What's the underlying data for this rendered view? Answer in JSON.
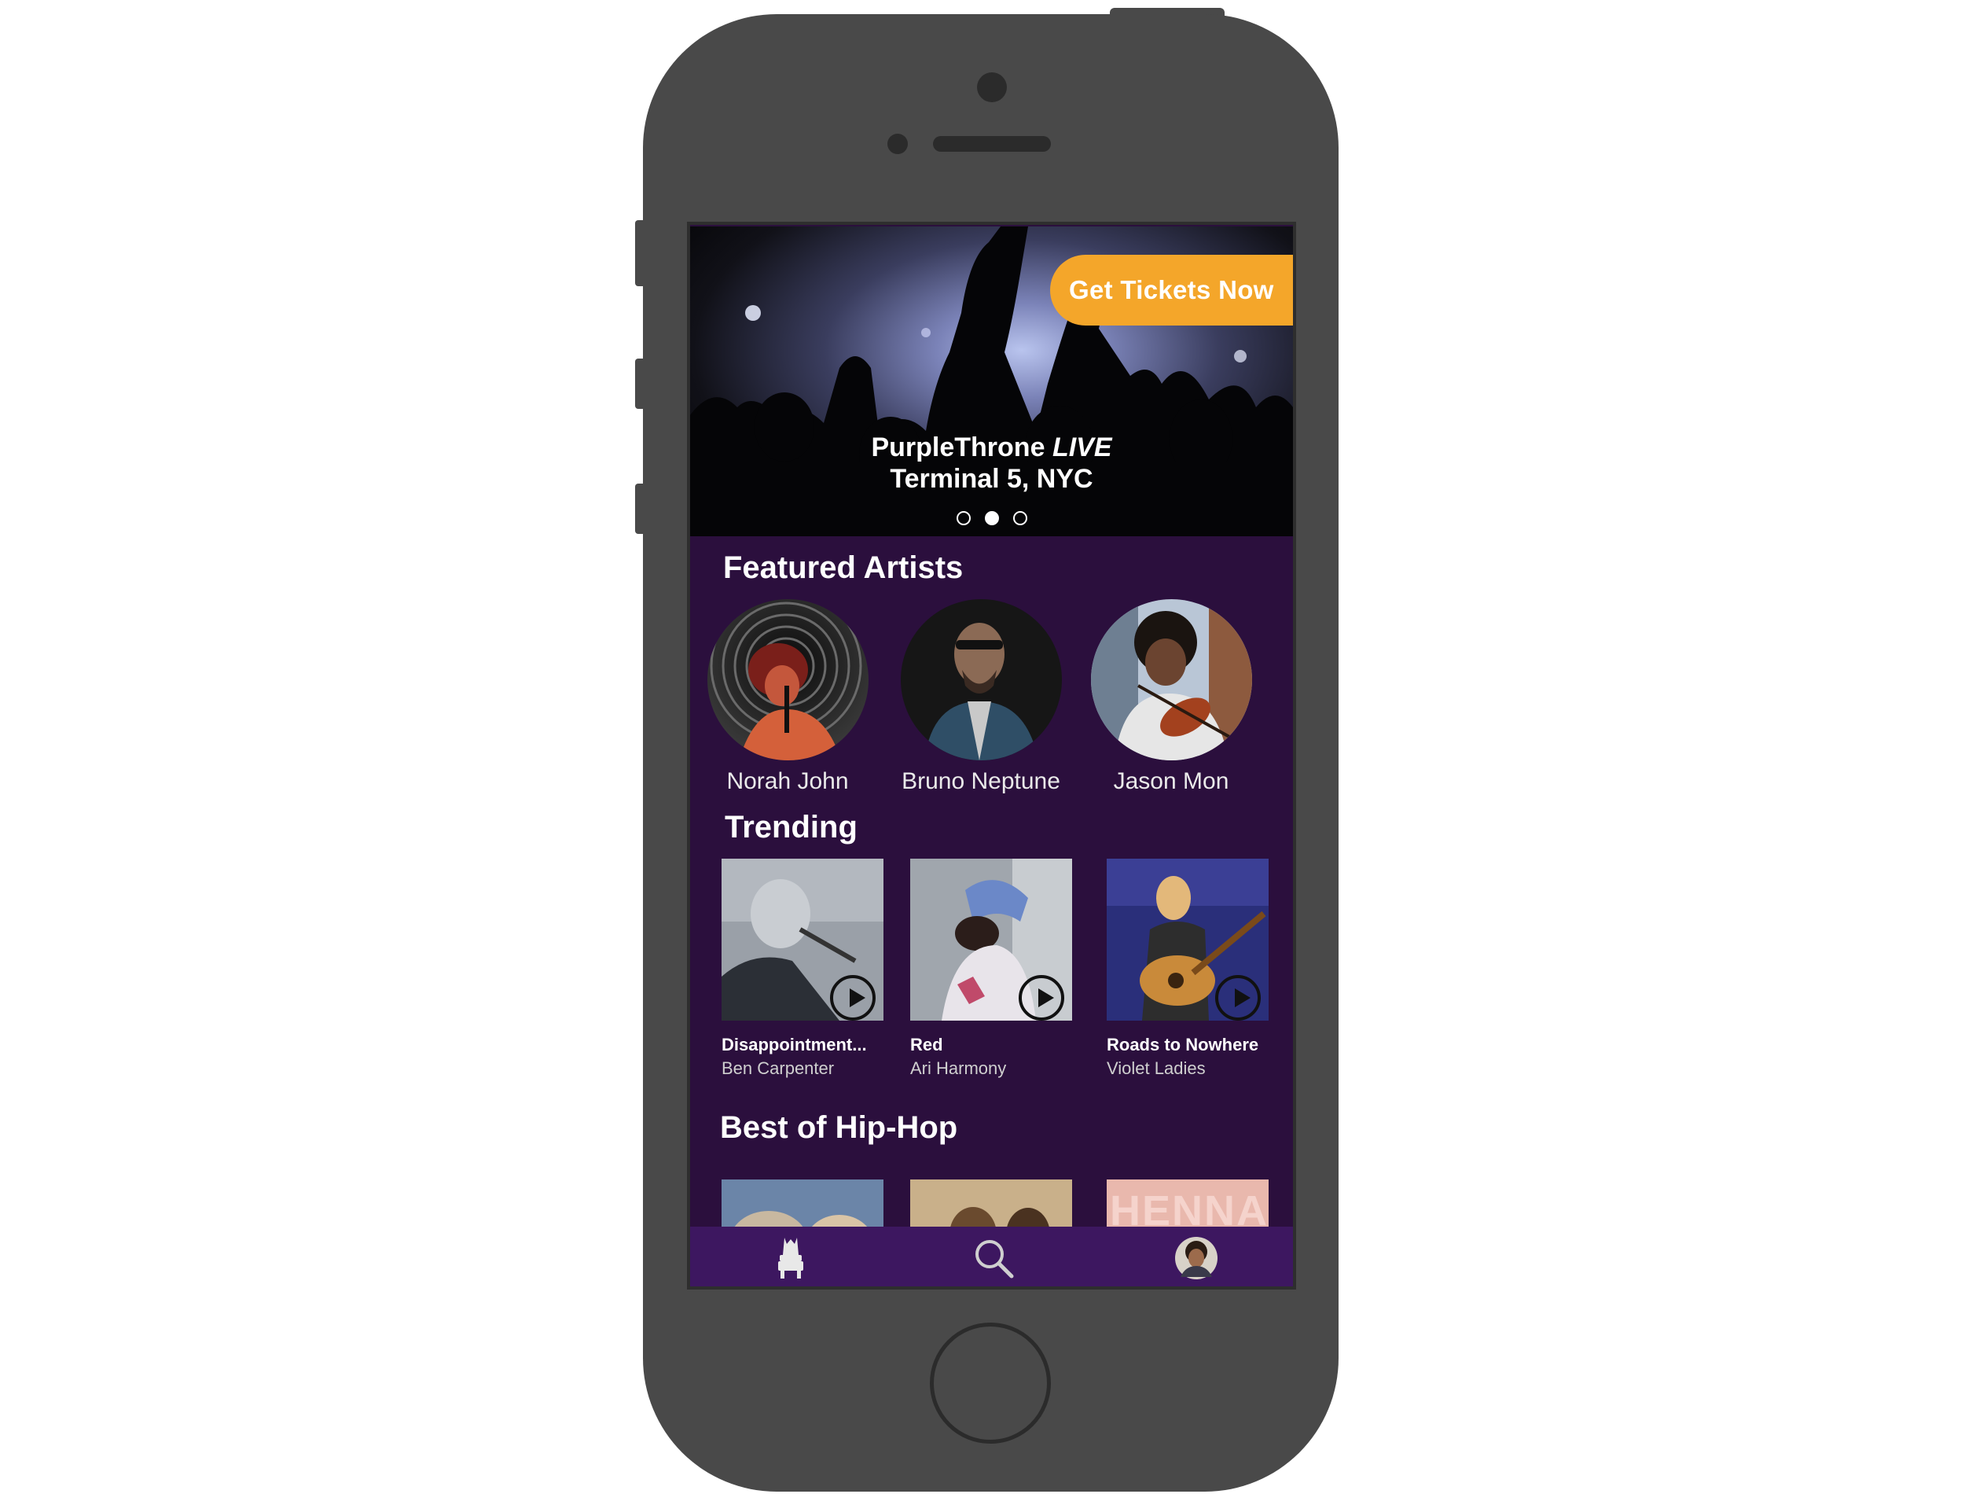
{
  "hero": {
    "cta_label": "Get Tickets Now",
    "event_name": "PurpleThrone",
    "event_tag": "LIVE",
    "venue": "Terminal 5, NYC",
    "carousel_active_index": 1,
    "carousel_count": 3
  },
  "featured": {
    "title": "Featured Artists",
    "artists": [
      {
        "name": "Norah John"
      },
      {
        "name": "Bruno Neptune"
      },
      {
        "name": "Jason Mon"
      }
    ]
  },
  "trending": {
    "title": "Trending",
    "tracks": [
      {
        "title": "Disappointment...",
        "artist": "Ben Carpenter"
      },
      {
        "title": "Red",
        "artist": "Ari Harmony"
      },
      {
        "title": "Roads to Nowhere",
        "artist": "Violet Ladies"
      }
    ]
  },
  "hiphop": {
    "title": "Best of Hip-Hop",
    "third_thumb_text": "HENNAI"
  },
  "nav": {
    "items": [
      {
        "icon": "throne-icon"
      },
      {
        "icon": "search-icon"
      },
      {
        "icon": "profile-avatar"
      }
    ]
  },
  "colors": {
    "background": "#2b0f3d",
    "accent": "#f4a62a",
    "nav": "#3d1760",
    "phone": "#494949"
  }
}
